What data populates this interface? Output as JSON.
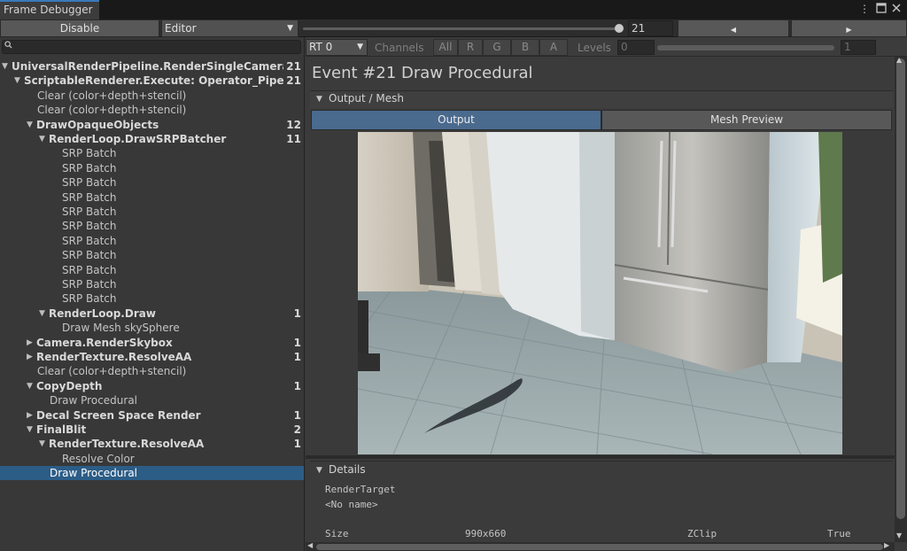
{
  "window": {
    "tab_label": "Frame Debugger",
    "more_icon": "kebab-icon",
    "maximize_icon": "maximize-icon",
    "close_icon": "close-icon"
  },
  "toolbar": {
    "disable_label": "Disable",
    "target_value": "Editor",
    "event_index": "21",
    "event_slider_fraction": 1.0,
    "prev_icon": "◀",
    "next_icon": "▶"
  },
  "search": {
    "value": "",
    "icon": "search-icon"
  },
  "tree": [
    {
      "label": "UniversalRenderPipeline.RenderSingleCameraInterr",
      "count": "21",
      "depth": 0,
      "arrow": "down",
      "bold": true
    },
    {
      "label": "ScriptableRenderer.Execute: Operator_PipelineA:",
      "count": "21",
      "depth": 1,
      "arrow": "down",
      "bold": true
    },
    {
      "label": "Clear (color+depth+stencil)",
      "count": "",
      "depth": 2,
      "arrow": "",
      "bold": false
    },
    {
      "label": "Clear (color+depth+stencil)",
      "count": "",
      "depth": 2,
      "arrow": "",
      "bold": false
    },
    {
      "label": "DrawOpaqueObjects",
      "count": "12",
      "depth": 2,
      "arrow": "down",
      "bold": true
    },
    {
      "label": "RenderLoop.DrawSRPBatcher",
      "count": "11",
      "depth": 3,
      "arrow": "down",
      "bold": true
    },
    {
      "label": "SRP Batch",
      "count": "",
      "depth": 4,
      "arrow": "",
      "bold": false
    },
    {
      "label": "SRP Batch",
      "count": "",
      "depth": 4,
      "arrow": "",
      "bold": false
    },
    {
      "label": "SRP Batch",
      "count": "",
      "depth": 4,
      "arrow": "",
      "bold": false
    },
    {
      "label": "SRP Batch",
      "count": "",
      "depth": 4,
      "arrow": "",
      "bold": false
    },
    {
      "label": "SRP Batch",
      "count": "",
      "depth": 4,
      "arrow": "",
      "bold": false
    },
    {
      "label": "SRP Batch",
      "count": "",
      "depth": 4,
      "arrow": "",
      "bold": false
    },
    {
      "label": "SRP Batch",
      "count": "",
      "depth": 4,
      "arrow": "",
      "bold": false
    },
    {
      "label": "SRP Batch",
      "count": "",
      "depth": 4,
      "arrow": "",
      "bold": false
    },
    {
      "label": "SRP Batch",
      "count": "",
      "depth": 4,
      "arrow": "",
      "bold": false
    },
    {
      "label": "SRP Batch",
      "count": "",
      "depth": 4,
      "arrow": "",
      "bold": false
    },
    {
      "label": "SRP Batch",
      "count": "",
      "depth": 4,
      "arrow": "",
      "bold": false
    },
    {
      "label": "RenderLoop.Draw",
      "count": "1",
      "depth": 3,
      "arrow": "down",
      "bold": true
    },
    {
      "label": "Draw Mesh skySphere",
      "count": "",
      "depth": 4,
      "arrow": "",
      "bold": false
    },
    {
      "label": "Camera.RenderSkybox",
      "count": "1",
      "depth": 2,
      "arrow": "right",
      "bold": true
    },
    {
      "label": "RenderTexture.ResolveAA",
      "count": "1",
      "depth": 2,
      "arrow": "right",
      "bold": true
    },
    {
      "label": "Clear (color+depth+stencil)",
      "count": "",
      "depth": 2,
      "arrow": "",
      "bold": false
    },
    {
      "label": "CopyDepth",
      "count": "1",
      "depth": 2,
      "arrow": "down",
      "bold": true
    },
    {
      "label": "Draw Procedural",
      "count": "",
      "depth": 3,
      "arrow": "",
      "bold": false
    },
    {
      "label": "Decal Screen Space Render",
      "count": "1",
      "depth": 2,
      "arrow": "right",
      "bold": true
    },
    {
      "label": "FinalBlit",
      "count": "2",
      "depth": 2,
      "arrow": "down",
      "bold": true
    },
    {
      "label": "RenderTexture.ResolveAA",
      "count": "1",
      "depth": 3,
      "arrow": "down",
      "bold": true
    },
    {
      "label": "Resolve Color",
      "count": "",
      "depth": 4,
      "arrow": "",
      "bold": false
    },
    {
      "label": "Draw Procedural",
      "count": "",
      "depth": 3,
      "arrow": "",
      "bold": false,
      "selected": true
    }
  ],
  "render_target": {
    "rt_value": "RT 0",
    "channels_label": "Channels",
    "channels": [
      "All",
      "R",
      "G",
      "B",
      "A"
    ],
    "levels_label": "Levels",
    "levels_min": "0",
    "levels_max": "1"
  },
  "event": {
    "title": "Event #21 Draw Procedural"
  },
  "output_mesh": {
    "section_title": "Output / Mesh",
    "tabs": [
      "Output",
      "Mesh Preview"
    ],
    "active_tab": "Output"
  },
  "details": {
    "section_title": "Details",
    "render_target_label": "RenderTarget",
    "render_target_value": "<No name>",
    "size_label": "Size",
    "size_value": "990x660",
    "zclip_label": "ZClip",
    "zclip_value": "True"
  },
  "colors": {
    "selection": "#2c5d87",
    "active_tab": "#4a6a8e",
    "panel": "#383838",
    "titlebar": "#191919"
  }
}
